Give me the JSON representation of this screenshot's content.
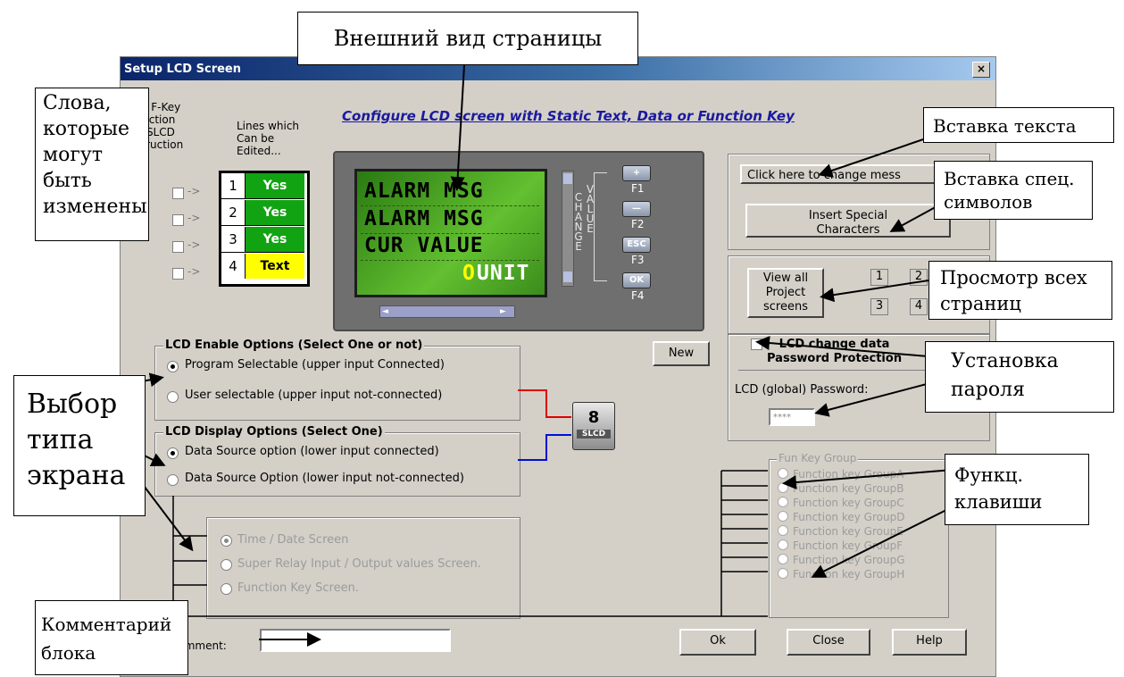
{
  "window": {
    "title": "Setup LCD Screen",
    "close_symbol": "×"
  },
  "header": {
    "fkey_selection": "One F-Key\nSelection\nPer SLCD\nInstruction",
    "editable_lines": "Lines which\nCan be\nEdited...",
    "configure_title": "Configure LCD screen with Static Text, Data or Function Key"
  },
  "lines": [
    {
      "num": "1",
      "status": "Yes"
    },
    {
      "num": "2",
      "status": "Yes"
    },
    {
      "num": "3",
      "status": "Yes"
    },
    {
      "num": "4",
      "status": "Text"
    }
  ],
  "lcd": {
    "lines": [
      "ALARM MSG",
      "ALARM MSG",
      "CUR VALUE"
    ],
    "line4_o": "O",
    "line4_unit": "UNIT",
    "change_value_letters_1": "CHANGE",
    "change_value_letters_2": "VALUE",
    "fkeys": [
      {
        "label": "+",
        "name": "F1"
      },
      {
        "label": "—",
        "name": "F2"
      },
      {
        "label": "ESC",
        "name": "F3"
      },
      {
        "label": "OK",
        "name": "F4"
      }
    ]
  },
  "buttons": {
    "change_message": "Click here to change mess",
    "insert_special": "Insert Special\nCharacters",
    "view_all": "View all\nProject\nscreens",
    "new": "New",
    "ok": "Ok",
    "close": "Close",
    "help": "Help"
  },
  "screen_numbers": [
    "1",
    "2",
    "3",
    "4"
  ],
  "password": {
    "checkbox_label": "LCD change data\nPassword Protection",
    "global_label": "LCD (global) Password:",
    "value": "****"
  },
  "enable_options": {
    "title": "LCD Enable Options (Select One or not)",
    "options": [
      "Program Selectable (upper input Connected)",
      "User selectable (upper input not-connected)"
    ],
    "selected": 0
  },
  "display_options": {
    "title": "LCD Display Options (Select One)",
    "options": [
      "Data Source option (lower input connected)",
      "Data Source Option (lower input not-connected)"
    ],
    "selected": 0
  },
  "slcd_block": {
    "number": "8",
    "label": "SLCD"
  },
  "screen_types": {
    "options": [
      "Time / Date Screen",
      "Super Relay Input / Output values Screen.",
      "Function Key Screen."
    ],
    "selected": 0
  },
  "fun_key_group": {
    "title": "Fun Key Group",
    "options": [
      "Function key GroupA",
      "Function key GroupB",
      "Function key GroupC",
      "Function key GroupD",
      "Function key GroupE",
      "Function key GroupF",
      "Function key GroupG",
      "Function key GroupH"
    ]
  },
  "comment": {
    "label": "Comment:",
    "value": ""
  },
  "callouts": {
    "page_view": "Внешний вид страницы",
    "editable_words": "Слова,\nкоторые\nмогут\nбыть\nизменены",
    "insert_text": "Вставка текста",
    "insert_special": "Вставка спец.\nсимволов",
    "view_pages": "Просмотр всех\nстраниц",
    "set_password": "Установка\nпароля",
    "screen_type": "Выбор\nтипа\nэкрана",
    "function_keys": "Функц.\nклавиши",
    "block_comment": "Комментарий\nблока"
  },
  "colors": {
    "yes_bg": "#12a312",
    "text_bg": "#ffff00",
    "lcd_green": "#63c030",
    "unit_color": "#ffff00",
    "title_blue": "#0a246a",
    "wire_red": "#e00000",
    "wire_blue": "#0010d0"
  }
}
